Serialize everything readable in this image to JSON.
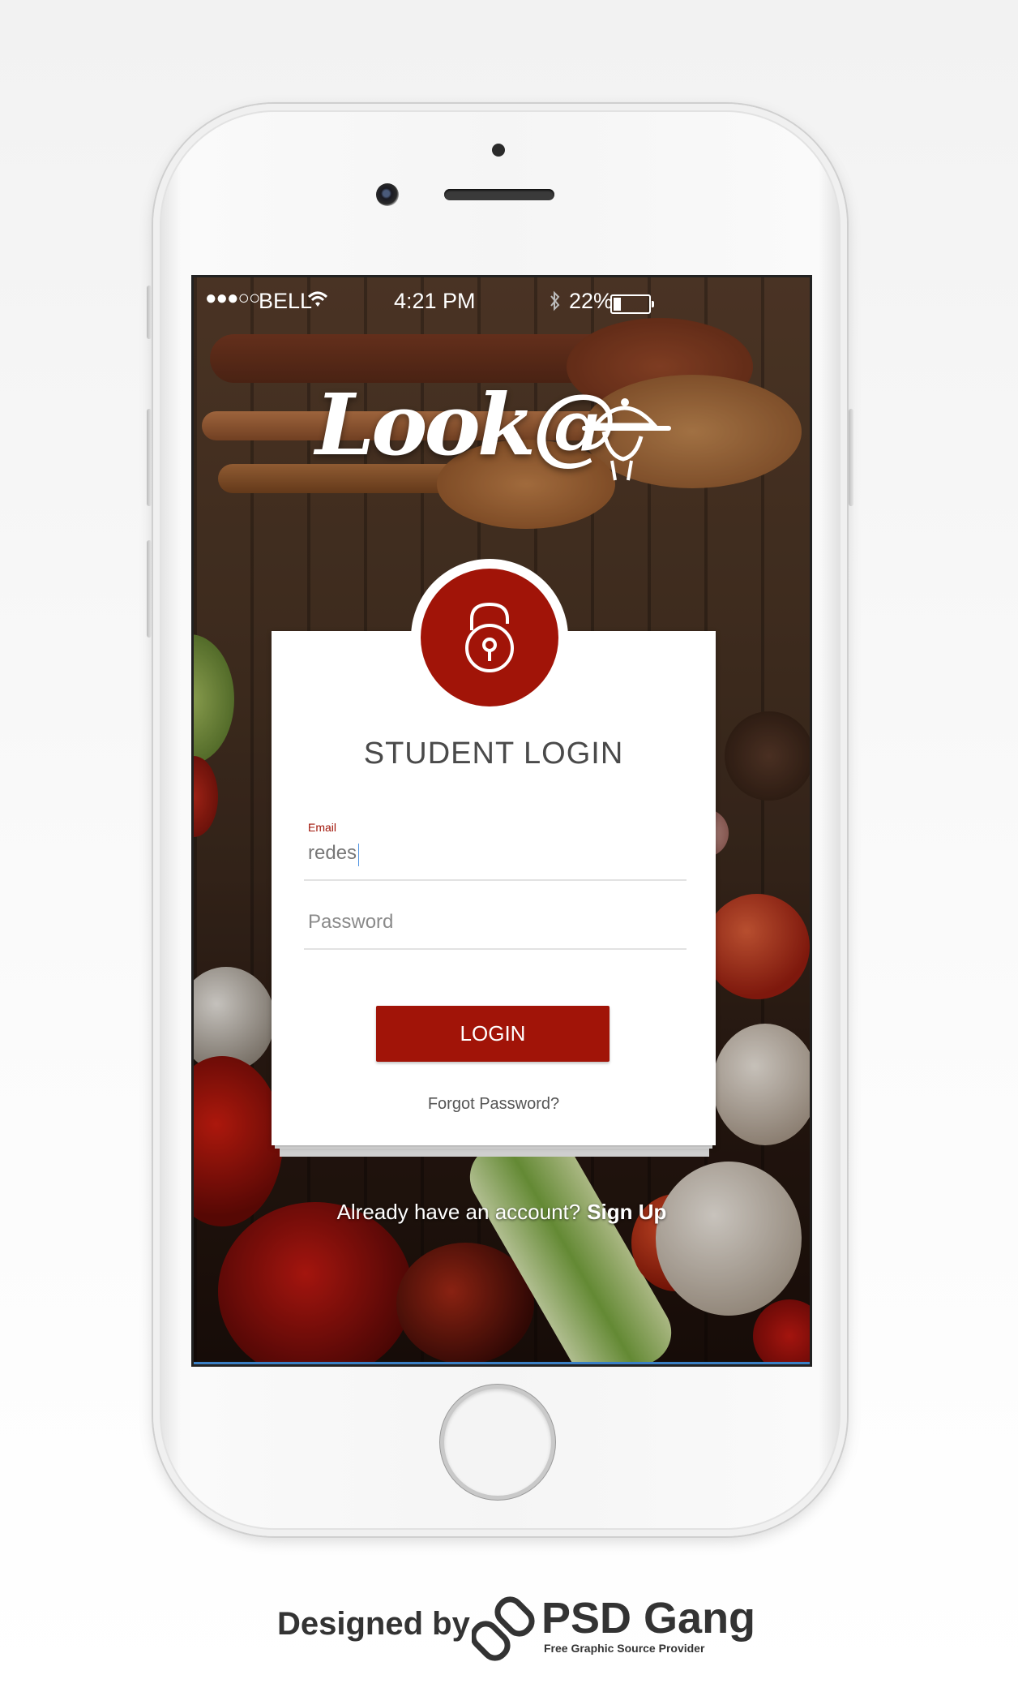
{
  "status_bar": {
    "signal": "●●●○○",
    "carrier": "BELL",
    "time": "4:21 PM",
    "battery": "22%"
  },
  "app": {
    "logo_text": "Look@"
  },
  "login": {
    "title": "STUDENT LOGIN",
    "email_label": "Email",
    "email_value": "redes",
    "password_placeholder": "Password",
    "button_label": "LOGIN",
    "forgot_label": "Forgot Password?",
    "signup_prompt": "Already have an account?",
    "signup_link": "Sign Up"
  },
  "footer": {
    "designed_by": "Designed by",
    "brand": "PSD Gang",
    "tagline": "Free Graphic Source Provider"
  },
  "colors": {
    "accent": "#a11408",
    "background": "#2a1a12"
  },
  "icons": [
    "wifi-icon",
    "bluetooth-icon",
    "battery-icon",
    "chef-cloche-icon",
    "unlock-icon",
    "psd-gang-link-icon"
  ]
}
